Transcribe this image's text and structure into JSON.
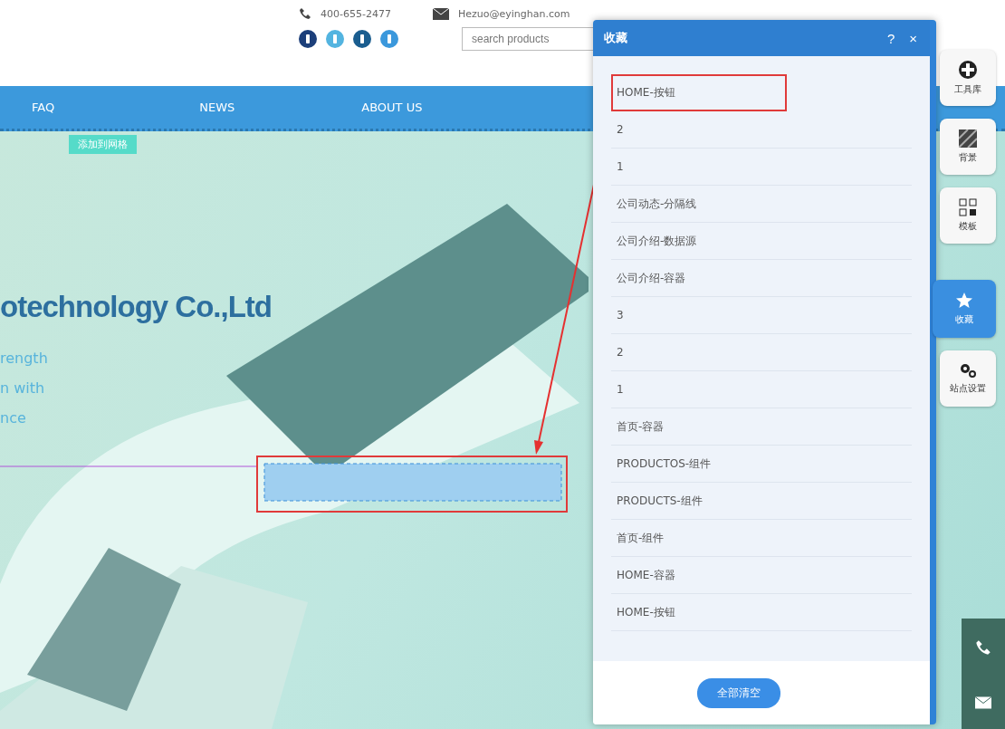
{
  "header": {
    "phone": "400-655-2477",
    "email": "Hezuo@eyinghan.com",
    "search": {
      "placeholder": "search products"
    }
  },
  "nav": {
    "items": [
      "FAQ",
      "NEWS",
      "ABOUT US"
    ]
  },
  "hero": {
    "badge": "添加到网格",
    "title": "otechnology Co.,Ltd",
    "lines": [
      "rength",
      "n with",
      "nce"
    ]
  },
  "panel": {
    "title": "收藏",
    "help": "?",
    "close": "×",
    "items": [
      {
        "label": "HOME-按钮",
        "highlighted": true
      },
      {
        "label": "2",
        "highlighted": false
      },
      {
        "label": "1",
        "highlighted": false
      },
      {
        "label": "公司动态-分隔线",
        "highlighted": false
      },
      {
        "label": "公司介绍-数据源",
        "highlighted": false
      },
      {
        "label": "公司介绍-容器",
        "highlighted": false
      },
      {
        "label": "3",
        "highlighted": false
      },
      {
        "label": "2",
        "highlighted": false
      },
      {
        "label": "1",
        "highlighted": false
      },
      {
        "label": "首页-容器",
        "highlighted": false
      },
      {
        "label": "PRODUCTOS-组件",
        "highlighted": false
      },
      {
        "label": "PRODUCTS-组件",
        "highlighted": false
      },
      {
        "label": "首页-组件",
        "highlighted": false
      },
      {
        "label": "HOME-容器",
        "highlighted": false
      },
      {
        "label": "HOME-按钮",
        "highlighted": false
      }
    ],
    "clear_button": "全部清空"
  },
  "toolbar": [
    {
      "kind": "library",
      "label": "工具库",
      "selected": false
    },
    {
      "kind": "background",
      "label": "背景",
      "selected": false
    },
    {
      "kind": "template",
      "label": "模板",
      "selected": false
    },
    {
      "kind": "favorites",
      "label": "收藏",
      "selected": true
    },
    {
      "kind": "settings",
      "label": "站点设置",
      "selected": false
    }
  ],
  "contact": [
    {
      "kind": "phone"
    },
    {
      "kind": "mail"
    }
  ]
}
